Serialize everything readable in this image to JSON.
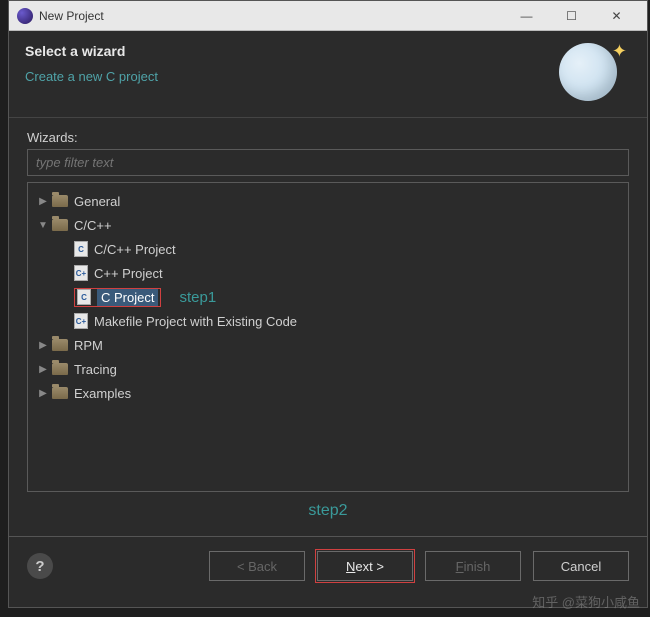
{
  "titlebar": {
    "title": "New Project"
  },
  "header": {
    "heading": "Select a wizard",
    "subtitle": "Create a new C project"
  },
  "wizards_label": "Wizards:",
  "filter_placeholder": "type filter text",
  "tree": {
    "general": "General",
    "ccpp": "C/C++",
    "ccpp_project": "C/C++ Project",
    "cpp_project": "C++ Project",
    "c_project": "C Project",
    "makefile_project": "Makefile Project with Existing Code",
    "rpm": "RPM",
    "tracing": "Tracing",
    "examples": "Examples"
  },
  "annotations": {
    "step1": "step1",
    "step2": "step2"
  },
  "buttons": {
    "back": "< Back",
    "next_pre": "N",
    "next_post": "ext >",
    "finish_pre": "F",
    "finish_post": "inish",
    "cancel": "Cancel"
  },
  "watermark": "知乎 @菜狗小咸鱼"
}
